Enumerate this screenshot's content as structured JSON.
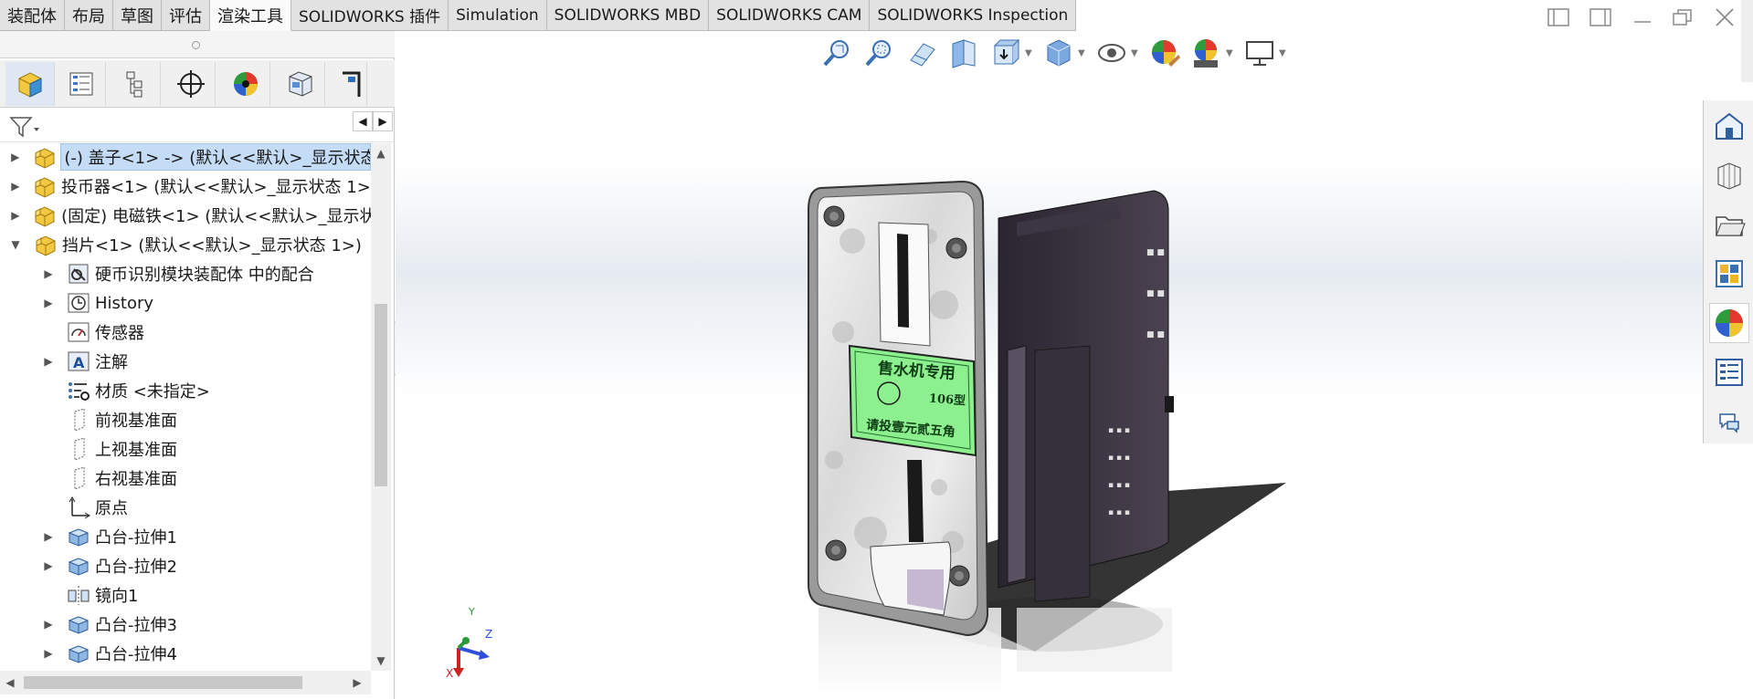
{
  "tabs": [
    "装配体",
    "布局",
    "草图",
    "评估",
    "渲染工具",
    "SOLIDWORKS 插件",
    "Simulation",
    "SOLIDWORKS MBD",
    "SOLIDWORKS CAM",
    "SOLIDWORKS Inspection"
  ],
  "active_tab": "渲染工具",
  "feature_tree": {
    "rows": [
      {
        "label": "(-) 盖子<1> -> (默认<<默认>_显示状态",
        "icon": "part-icon",
        "expand": "right"
      },
      {
        "label": "投币器<1> (默认<<默认>_显示状态 1>)",
        "icon": "part-icon",
        "expand": "right"
      },
      {
        "label": "(固定) 电磁铁<1> (默认<<默认>_显示状",
        "icon": "part-icon",
        "expand": "right"
      },
      {
        "label": "挡片<1> (默认<<默认>_显示状态 1>)",
        "icon": "part-icon",
        "expand": "down"
      },
      {
        "label": "硬币识别模块装配体 中的配合",
        "icon": "mates-icon",
        "expand": "right"
      },
      {
        "label": "History",
        "icon": "history-icon",
        "expand": "right"
      },
      {
        "label": "传感器",
        "icon": "sensor-icon",
        "expand": ""
      },
      {
        "label": "注解",
        "icon": "annotation-icon",
        "expand": "right"
      },
      {
        "label": "材质 <未指定>",
        "icon": "material-icon",
        "expand": ""
      },
      {
        "label": "前视基准面",
        "icon": "plane-icon",
        "expand": ""
      },
      {
        "label": "上视基准面",
        "icon": "plane-icon",
        "expand": ""
      },
      {
        "label": "右视基准面",
        "icon": "plane-icon",
        "expand": ""
      },
      {
        "label": "原点",
        "icon": "origin-icon",
        "expand": ""
      },
      {
        "label": "凸台-拉伸1",
        "icon": "extrude-icon",
        "expand": "right"
      },
      {
        "label": "凸台-拉伸2",
        "icon": "extrude-icon",
        "expand": "right"
      },
      {
        "label": "镜向1",
        "icon": "mirror-icon",
        "expand": ""
      },
      {
        "label": "凸台-拉伸3",
        "icon": "extrude-icon",
        "expand": "right"
      },
      {
        "label": "凸台-拉伸4",
        "icon": "extrude-icon",
        "expand": "right"
      }
    ]
  },
  "model": {
    "label_title": "售水机专用",
    "label_model": "106型",
    "label_instruction": "请投壹元贰五角",
    "label_color": "#8df08f"
  },
  "triad": {
    "x": "X",
    "y": "Y",
    "z": "Z"
  },
  "colors": {
    "accent": "#2b6cc4",
    "selection": "#c4dcf5"
  }
}
